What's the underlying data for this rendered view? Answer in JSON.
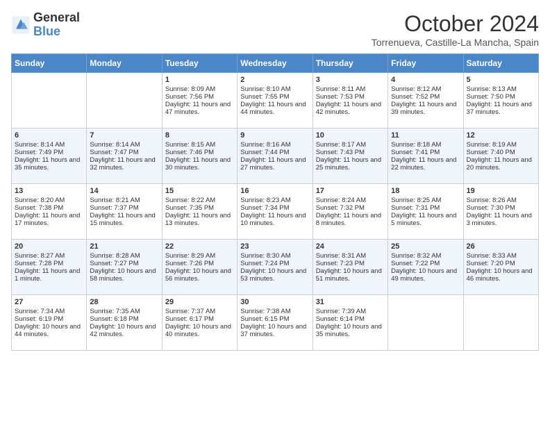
{
  "logo": {
    "line1": "General",
    "line2": "Blue"
  },
  "title": "October 2024",
  "subtitle": "Torrenueva, Castille-La Mancha, Spain",
  "weekdays": [
    "Sunday",
    "Monday",
    "Tuesday",
    "Wednesday",
    "Thursday",
    "Friday",
    "Saturday"
  ],
  "weeks": [
    [
      {
        "day": "",
        "sunrise": "",
        "sunset": "",
        "daylight": ""
      },
      {
        "day": "",
        "sunrise": "",
        "sunset": "",
        "daylight": ""
      },
      {
        "day": "1",
        "sunrise": "Sunrise: 8:09 AM",
        "sunset": "Sunset: 7:56 PM",
        "daylight": "Daylight: 11 hours and 47 minutes."
      },
      {
        "day": "2",
        "sunrise": "Sunrise: 8:10 AM",
        "sunset": "Sunset: 7:55 PM",
        "daylight": "Daylight: 11 hours and 44 minutes."
      },
      {
        "day": "3",
        "sunrise": "Sunrise: 8:11 AM",
        "sunset": "Sunset: 7:53 PM",
        "daylight": "Daylight: 11 hours and 42 minutes."
      },
      {
        "day": "4",
        "sunrise": "Sunrise: 8:12 AM",
        "sunset": "Sunset: 7:52 PM",
        "daylight": "Daylight: 11 hours and 39 minutes."
      },
      {
        "day": "5",
        "sunrise": "Sunrise: 8:13 AM",
        "sunset": "Sunset: 7:50 PM",
        "daylight": "Daylight: 11 hours and 37 minutes."
      }
    ],
    [
      {
        "day": "6",
        "sunrise": "Sunrise: 8:14 AM",
        "sunset": "Sunset: 7:49 PM",
        "daylight": "Daylight: 11 hours and 35 minutes."
      },
      {
        "day": "7",
        "sunrise": "Sunrise: 8:14 AM",
        "sunset": "Sunset: 7:47 PM",
        "daylight": "Daylight: 11 hours and 32 minutes."
      },
      {
        "day": "8",
        "sunrise": "Sunrise: 8:15 AM",
        "sunset": "Sunset: 7:46 PM",
        "daylight": "Daylight: 11 hours and 30 minutes."
      },
      {
        "day": "9",
        "sunrise": "Sunrise: 8:16 AM",
        "sunset": "Sunset: 7:44 PM",
        "daylight": "Daylight: 11 hours and 27 minutes."
      },
      {
        "day": "10",
        "sunrise": "Sunrise: 8:17 AM",
        "sunset": "Sunset: 7:43 PM",
        "daylight": "Daylight: 11 hours and 25 minutes."
      },
      {
        "day": "11",
        "sunrise": "Sunrise: 8:18 AM",
        "sunset": "Sunset: 7:41 PM",
        "daylight": "Daylight: 11 hours and 22 minutes."
      },
      {
        "day": "12",
        "sunrise": "Sunrise: 8:19 AM",
        "sunset": "Sunset: 7:40 PM",
        "daylight": "Daylight: 11 hours and 20 minutes."
      }
    ],
    [
      {
        "day": "13",
        "sunrise": "Sunrise: 8:20 AM",
        "sunset": "Sunset: 7:38 PM",
        "daylight": "Daylight: 11 hours and 17 minutes."
      },
      {
        "day": "14",
        "sunrise": "Sunrise: 8:21 AM",
        "sunset": "Sunset: 7:37 PM",
        "daylight": "Daylight: 11 hours and 15 minutes."
      },
      {
        "day": "15",
        "sunrise": "Sunrise: 8:22 AM",
        "sunset": "Sunset: 7:35 PM",
        "daylight": "Daylight: 11 hours and 13 minutes."
      },
      {
        "day": "16",
        "sunrise": "Sunrise: 8:23 AM",
        "sunset": "Sunset: 7:34 PM",
        "daylight": "Daylight: 11 hours and 10 minutes."
      },
      {
        "day": "17",
        "sunrise": "Sunrise: 8:24 AM",
        "sunset": "Sunset: 7:32 PM",
        "daylight": "Daylight: 11 hours and 8 minutes."
      },
      {
        "day": "18",
        "sunrise": "Sunrise: 8:25 AM",
        "sunset": "Sunset: 7:31 PM",
        "daylight": "Daylight: 11 hours and 5 minutes."
      },
      {
        "day": "19",
        "sunrise": "Sunrise: 8:26 AM",
        "sunset": "Sunset: 7:30 PM",
        "daylight": "Daylight: 11 hours and 3 minutes."
      }
    ],
    [
      {
        "day": "20",
        "sunrise": "Sunrise: 8:27 AM",
        "sunset": "Sunset: 7:28 PM",
        "daylight": "Daylight: 11 hours and 1 minute."
      },
      {
        "day": "21",
        "sunrise": "Sunrise: 8:28 AM",
        "sunset": "Sunset: 7:27 PM",
        "daylight": "Daylight: 10 hours and 58 minutes."
      },
      {
        "day": "22",
        "sunrise": "Sunrise: 8:29 AM",
        "sunset": "Sunset: 7:26 PM",
        "daylight": "Daylight: 10 hours and 56 minutes."
      },
      {
        "day": "23",
        "sunrise": "Sunrise: 8:30 AM",
        "sunset": "Sunset: 7:24 PM",
        "daylight": "Daylight: 10 hours and 53 minutes."
      },
      {
        "day": "24",
        "sunrise": "Sunrise: 8:31 AM",
        "sunset": "Sunset: 7:23 PM",
        "daylight": "Daylight: 10 hours and 51 minutes."
      },
      {
        "day": "25",
        "sunrise": "Sunrise: 8:32 AM",
        "sunset": "Sunset: 7:22 PM",
        "daylight": "Daylight: 10 hours and 49 minutes."
      },
      {
        "day": "26",
        "sunrise": "Sunrise: 8:33 AM",
        "sunset": "Sunset: 7:20 PM",
        "daylight": "Daylight: 10 hours and 46 minutes."
      }
    ],
    [
      {
        "day": "27",
        "sunrise": "Sunrise: 7:34 AM",
        "sunset": "Sunset: 6:19 PM",
        "daylight": "Daylight: 10 hours and 44 minutes."
      },
      {
        "day": "28",
        "sunrise": "Sunrise: 7:35 AM",
        "sunset": "Sunset: 6:18 PM",
        "daylight": "Daylight: 10 hours and 42 minutes."
      },
      {
        "day": "29",
        "sunrise": "Sunrise: 7:37 AM",
        "sunset": "Sunset: 6:17 PM",
        "daylight": "Daylight: 10 hours and 40 minutes."
      },
      {
        "day": "30",
        "sunrise": "Sunrise: 7:38 AM",
        "sunset": "Sunset: 6:15 PM",
        "daylight": "Daylight: 10 hours and 37 minutes."
      },
      {
        "day": "31",
        "sunrise": "Sunrise: 7:39 AM",
        "sunset": "Sunset: 6:14 PM",
        "daylight": "Daylight: 10 hours and 35 minutes."
      },
      {
        "day": "",
        "sunrise": "",
        "sunset": "",
        "daylight": ""
      },
      {
        "day": "",
        "sunrise": "",
        "sunset": "",
        "daylight": ""
      }
    ]
  ]
}
